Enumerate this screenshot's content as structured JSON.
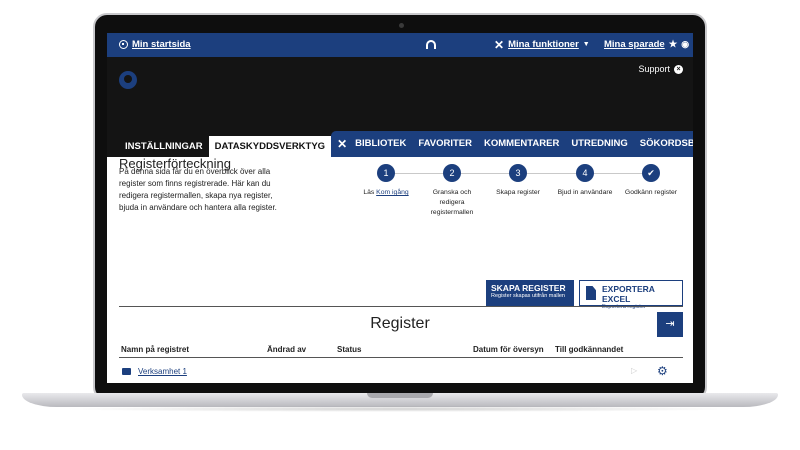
{
  "topbar": {
    "home_link": "Min startsida",
    "functions_link": "Mina funktioner",
    "saved_link": "Mina sparade"
  },
  "header": {
    "support_label": "Support"
  },
  "tabs": [
    "INSTÄLLNINGAR",
    "DATASKYDDSVERKTYG",
    "BIBLIOTEK",
    "FAVORITER",
    "KOMMENTARER",
    "UTREDNING",
    "SÖKORDSBEVAKNING"
  ],
  "page": {
    "title": "Registerförteckning",
    "intro": "På denna sida får du en överblick över alla register som finns registrerade. Här kan du redigera registermallen, skapa nya register, bjuda in användare och hantera alla register."
  },
  "steps": [
    {
      "number": "1",
      "label_prefix": "Läs ",
      "link": "Kom igång"
    },
    {
      "number": "2",
      "label": "Granska och redigera registermallen"
    },
    {
      "number": "3",
      "label": "Skapa register"
    },
    {
      "number": "4",
      "label": "Bjud in användare"
    },
    {
      "number": "✔",
      "label": "Godkänn register"
    }
  ],
  "buttons": {
    "create_title": "SKAPA REGISTER",
    "create_sub": "Register skapas utifrån mallen",
    "export_title": "EXPORTERA EXCEL",
    "export_sub": "Exportera register"
  },
  "register": {
    "title": "Register",
    "columns": [
      "Namn på registret",
      "Ändrad av",
      "Status",
      "Datum för översyn",
      "Till godkännandet"
    ],
    "rows": [
      {
        "name": "Verksamhet 1"
      }
    ]
  },
  "colors": {
    "brand": "#1c3f7e",
    "dark": "#141414"
  }
}
